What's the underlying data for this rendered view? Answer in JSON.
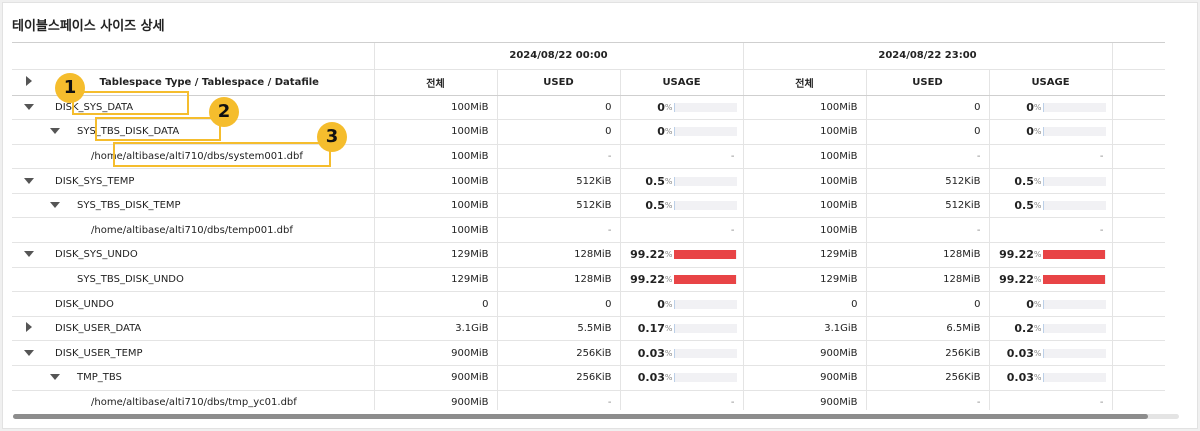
{
  "title": "테이블스페이스 사이즈 상세",
  "header": {
    "main_col": "Tablespace Type / Tablespace / Datafile",
    "groups": [
      "2024/08/22 00:00",
      "2024/08/22 23:00"
    ],
    "sub_cols": [
      "전체",
      "USED",
      "USAGE"
    ]
  },
  "rows": [
    {
      "name": "DISK_SYS_DATA",
      "level": 0,
      "toggle": "down",
      "g1": {
        "total": "100MiB",
        "used": "0",
        "usage": "0",
        "usage_pct": 0
      },
      "g2": {
        "total": "100MiB",
        "used": "0",
        "usage": "0",
        "usage_pct": 0
      }
    },
    {
      "name": "SYS_TBS_DISK_DATA",
      "level": 1,
      "toggle": "down",
      "g1": {
        "total": "100MiB",
        "used": "0",
        "usage": "0",
        "usage_pct": 0
      },
      "g2": {
        "total": "100MiB",
        "used": "0",
        "usage": "0",
        "usage_pct": 0
      }
    },
    {
      "name": "/home/altibase/alti710/dbs/system001.dbf",
      "level": 2,
      "toggle": "",
      "g1": {
        "total": "100MiB",
        "used": "-",
        "usage": "-"
      },
      "g2": {
        "total": "100MiB",
        "used": "-",
        "usage": "-"
      }
    },
    {
      "name": "DISK_SYS_TEMP",
      "level": 0,
      "toggle": "down",
      "g1": {
        "total": "100MiB",
        "used": "512KiB",
        "usage": "0.5",
        "usage_pct": 0.5
      },
      "g2": {
        "total": "100MiB",
        "used": "512KiB",
        "usage": "0.5",
        "usage_pct": 0.5
      }
    },
    {
      "name": "SYS_TBS_DISK_TEMP",
      "level": 1,
      "toggle": "down",
      "g1": {
        "total": "100MiB",
        "used": "512KiB",
        "usage": "0.5",
        "usage_pct": 0.5
      },
      "g2": {
        "total": "100MiB",
        "used": "512KiB",
        "usage": "0.5",
        "usage_pct": 0.5
      }
    },
    {
      "name": "/home/altibase/alti710/dbs/temp001.dbf",
      "level": 2,
      "toggle": "",
      "g1": {
        "total": "100MiB",
        "used": "-",
        "usage": "-"
      },
      "g2": {
        "total": "100MiB",
        "used": "-",
        "usage": "-"
      }
    },
    {
      "name": "DISK_SYS_UNDO",
      "level": 0,
      "toggle": "down",
      "g1": {
        "total": "129MiB",
        "used": "128MiB",
        "usage": "99.22",
        "usage_pct": 99.22
      },
      "g2": {
        "total": "129MiB",
        "used": "128MiB",
        "usage": "99.22",
        "usage_pct": 99.22
      }
    },
    {
      "name": "SYS_TBS_DISK_UNDO",
      "level": 1,
      "toggle": "",
      "g1": {
        "total": "129MiB",
        "used": "128MiB",
        "usage": "99.22",
        "usage_pct": 99.22
      },
      "g2": {
        "total": "129MiB",
        "used": "128MiB",
        "usage": "99.22",
        "usage_pct": 99.22
      }
    },
    {
      "name": "DISK_UNDO",
      "level": 0,
      "toggle": "",
      "g1": {
        "total": "0",
        "used": "0",
        "usage": "0",
        "usage_pct": 0
      },
      "g2": {
        "total": "0",
        "used": "0",
        "usage": "0",
        "usage_pct": 0
      }
    },
    {
      "name": "DISK_USER_DATA",
      "level": 0,
      "toggle": "right",
      "g1": {
        "total": "3.1GiB",
        "used": "5.5MiB",
        "usage": "0.17",
        "usage_pct": 0.17
      },
      "g2": {
        "total": "3.1GiB",
        "used": "6.5MiB",
        "usage": "0.2",
        "usage_pct": 0.2
      }
    },
    {
      "name": "DISK_USER_TEMP",
      "level": 0,
      "toggle": "down",
      "g1": {
        "total": "900MiB",
        "used": "256KiB",
        "usage": "0.03",
        "usage_pct": 0.03
      },
      "g2": {
        "total": "900MiB",
        "used": "256KiB",
        "usage": "0.03",
        "usage_pct": 0.03
      }
    },
    {
      "name": "TMP_TBS",
      "level": 1,
      "toggle": "down",
      "g1": {
        "total": "900MiB",
        "used": "256KiB",
        "usage": "0.03",
        "usage_pct": 0.03
      },
      "g2": {
        "total": "900MiB",
        "used": "256KiB",
        "usage": "0.03",
        "usage_pct": 0.03
      }
    },
    {
      "name": "/home/altibase/alti710/dbs/tmp_yc01.dbf",
      "level": 2,
      "toggle": "",
      "g1": {
        "total": "900MiB",
        "used": "-",
        "usage": "-"
      },
      "g2": {
        "total": "900MiB",
        "used": "-",
        "usage": "-"
      }
    }
  ],
  "pct_symbol": "%",
  "callouts": [
    "1",
    "2",
    "3"
  ],
  "colors": {
    "highlight": "#f5bd2d",
    "bar_high": "#e84446",
    "bar_low": "#bcd0e8"
  }
}
